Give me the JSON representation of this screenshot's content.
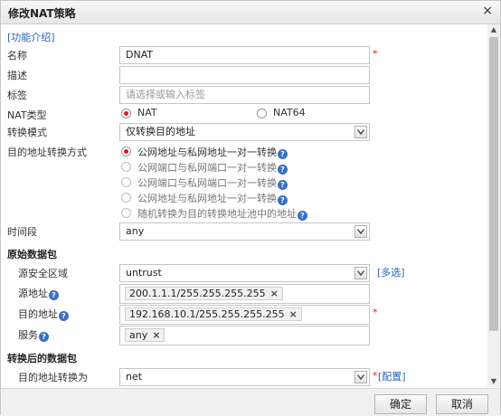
{
  "dialog": {
    "title": "修改NAT策略",
    "close_symbol": "×"
  },
  "help_link": "[功能介绍]",
  "fields": {
    "name": {
      "label": "名称",
      "value": "DNAT",
      "required": "*"
    },
    "description": {
      "label": "描述",
      "value": ""
    },
    "tags": {
      "label": "标签",
      "placeholder": "请选择或输入标签"
    },
    "nat_type": {
      "label": "NAT类型",
      "options": [
        "NAT",
        "NAT64"
      ],
      "selected": "NAT"
    },
    "convert_mode": {
      "label": "转换模式",
      "value": "仅转换目的地址"
    },
    "dest_convert_method": {
      "label": "目的地址转换方式",
      "options": [
        "公网地址与私网地址一对一转换",
        "公网端口与私网端口一对一转换",
        "公网端口与私网端口一对一转换",
        "公网地址与私网地址一对一转换",
        "随机转换为目的转换地址池中的地址"
      ],
      "help": "?"
    },
    "time_range": {
      "label": "时间段",
      "value": "any"
    }
  },
  "original_packet": {
    "section_title": "原始数据包",
    "source_zone": {
      "label": "源安全区域",
      "value": "untrust",
      "link": "[多选]"
    },
    "source_address": {
      "label": "源地址",
      "help": "?",
      "tag": "200.1.1.1/255.255.255.255",
      "remove": "×"
    },
    "dest_address": {
      "label": "目的地址",
      "help": "?",
      "tag": "192.168.10.1/255.255.255.255",
      "remove": "×",
      "required": "*"
    },
    "service": {
      "label": "服务",
      "help": "?",
      "tag": "any",
      "remove": "×"
    }
  },
  "translated_packet": {
    "section_title": "转换后的数据包",
    "dest_translate_to": {
      "label": "目的地址转换为",
      "value": "net",
      "required": "*",
      "link": "[配置]"
    }
  },
  "footer": {
    "ok_label": "确定",
    "cancel_label": "取消"
  },
  "colors": {
    "link": "#2a64b7",
    "required": "#e02020",
    "radio_selected": "#d81b1b",
    "help_badge": "#3a6fc4"
  }
}
